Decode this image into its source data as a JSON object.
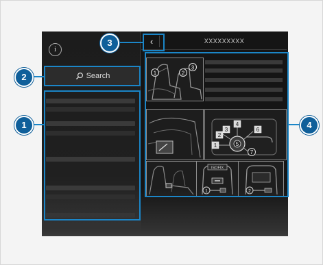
{
  "header": {
    "info_glyph": "i",
    "back_glyph": "‹",
    "title": "XXXXXXXXX"
  },
  "search": {
    "label": "Search"
  },
  "illustrations": {
    "seat_markers": [
      "1",
      "2",
      "3"
    ],
    "control_markers": [
      "1",
      "2",
      "3",
      "4",
      "5",
      "6",
      "7"
    ],
    "isofix_label": "ISOFIX",
    "isofix_markers": [
      "1",
      "2"
    ]
  },
  "callouts": [
    "1",
    "2",
    "3",
    "4"
  ],
  "colors": {
    "callout_blue": "#1b86c8",
    "badge_blue": "#0f5f9a",
    "screen_bg": "#151515"
  }
}
